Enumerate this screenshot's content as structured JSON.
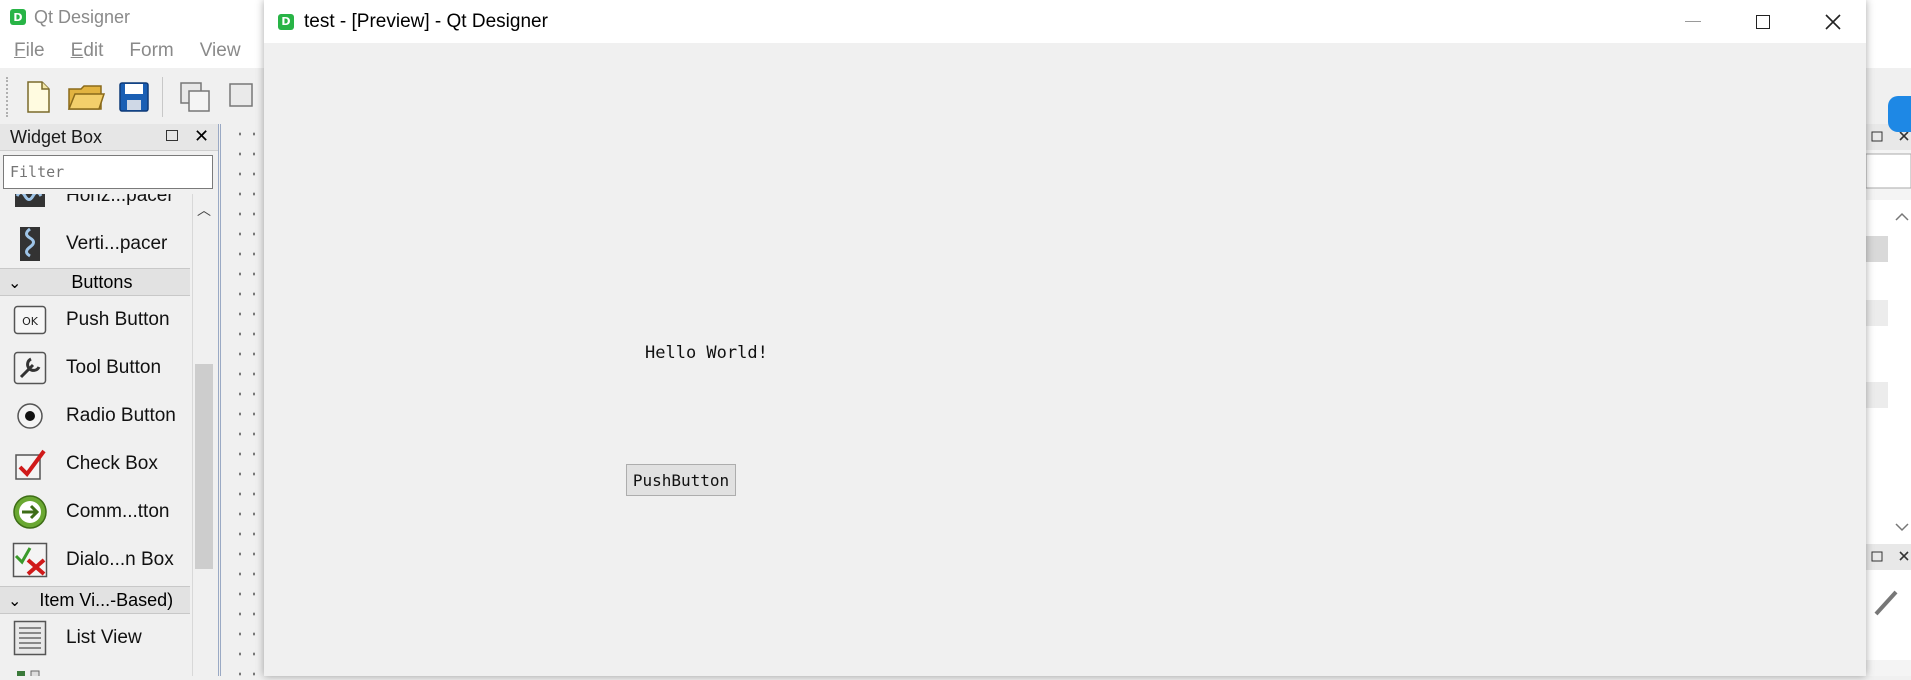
{
  "main_window": {
    "app_icon_letter": "D",
    "title": "Qt Designer",
    "menu": [
      {
        "underline": "F",
        "rest": "ile"
      },
      {
        "underline": "E",
        "rest": "dit"
      },
      {
        "underline": "",
        "rest": "Form"
      },
      {
        "underline": "",
        "rest": "View"
      }
    ],
    "toolbar_icons": [
      "new-file-icon",
      "open-folder-icon",
      "save-icon",
      "widget-mode-icon",
      "window-mode-icon"
    ]
  },
  "widget_box": {
    "title": "Widget Box",
    "filter_placeholder": "Filter",
    "items": [
      {
        "label": "Horiz...pacer",
        "icon": "horizontal-spacer-icon"
      },
      {
        "label": "Verti...pacer",
        "icon": "vertical-spacer-icon"
      }
    ],
    "categories": [
      {
        "label": "Buttons",
        "items": [
          {
            "label": "Push Button",
            "icon": "push-button-icon",
            "icon_text": "OK"
          },
          {
            "label": "Tool Button",
            "icon": "tool-button-icon"
          },
          {
            "label": "Radio Button",
            "icon": "radio-button-icon"
          },
          {
            "label": "Check Box",
            "icon": "check-box-icon"
          },
          {
            "label": "Comm...tton",
            "icon": "command-link-icon"
          },
          {
            "label": "Dialo...n Box",
            "icon": "dialog-button-box-icon"
          }
        ]
      },
      {
        "label": "Item Vi...-Based)",
        "items": [
          {
            "label": "List View",
            "icon": "list-view-icon"
          }
        ]
      }
    ]
  },
  "preview_window": {
    "app_icon_letter": "D",
    "title": "test - [Preview] - Qt Designer",
    "label_text": "Hello World!",
    "button_text": "PushButton"
  },
  "colors": {
    "app_icon": "#28b446",
    "background": "#f0f0f0",
    "accent_blue": "#1e88e5"
  }
}
